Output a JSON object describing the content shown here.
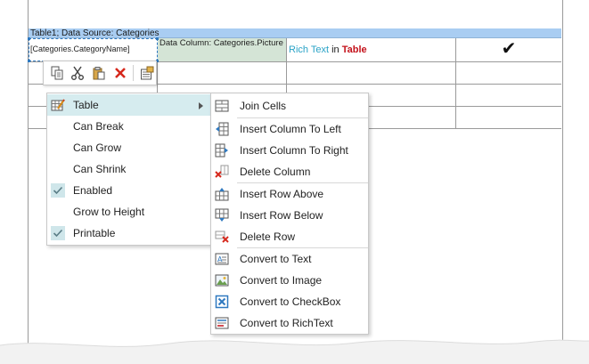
{
  "band": {
    "header_text": "Table1; Data Source: Categories"
  },
  "cells": {
    "category_name": "[Categories.CategoryName]",
    "picture": "Data Column: Categories.Picture",
    "rich_text_part1": "Rich Text",
    "rich_text_part2": " in ",
    "rich_text_part3": "Table",
    "check_mark": "✔"
  },
  "mini_toolbar": {
    "buttons": [
      "copy-icon",
      "cut-icon",
      "paste-icon",
      "delete-icon",
      "properties-icon"
    ]
  },
  "context_menu": {
    "items": [
      {
        "label": "Table",
        "icon": "table-edit-icon",
        "has_submenu": true,
        "active": true
      },
      {
        "label": "Can Break",
        "checked": false
      },
      {
        "label": "Can Grow",
        "checked": false
      },
      {
        "label": "Can Shrink",
        "checked": false
      },
      {
        "label": "Enabled",
        "checked": true
      },
      {
        "label": "Grow to Height",
        "checked": false
      },
      {
        "label": "Printable",
        "checked": true
      }
    ]
  },
  "table_submenu": {
    "items": [
      {
        "label": "Join Cells",
        "icon": "join-cells-icon"
      },
      {
        "label": "Insert Column To Left",
        "icon": "insert-column-left-icon"
      },
      {
        "label": "Insert Column To Right",
        "icon": "insert-column-right-icon"
      },
      {
        "label": "Delete Column",
        "icon": "delete-column-icon"
      },
      {
        "label": "Insert Row Above",
        "icon": "insert-row-above-icon"
      },
      {
        "label": "Insert Row Below",
        "icon": "insert-row-below-icon"
      },
      {
        "label": "Delete Row",
        "icon": "delete-row-icon"
      },
      {
        "label": "Convert to Text",
        "icon": "convert-text-icon"
      },
      {
        "label": "Convert to Image",
        "icon": "convert-image-icon"
      },
      {
        "label": "Convert to CheckBox",
        "icon": "convert-checkbox-icon"
      },
      {
        "label": "Convert to RichText",
        "icon": "convert-richtext-icon"
      }
    ]
  },
  "colors": {
    "band_header": "#a9cdf2",
    "picture_cell": "#d4e4d6",
    "menu_highlight": "#d6ecef",
    "rich_accent": "#2aa3c7",
    "rich_table": "#c4121b"
  }
}
